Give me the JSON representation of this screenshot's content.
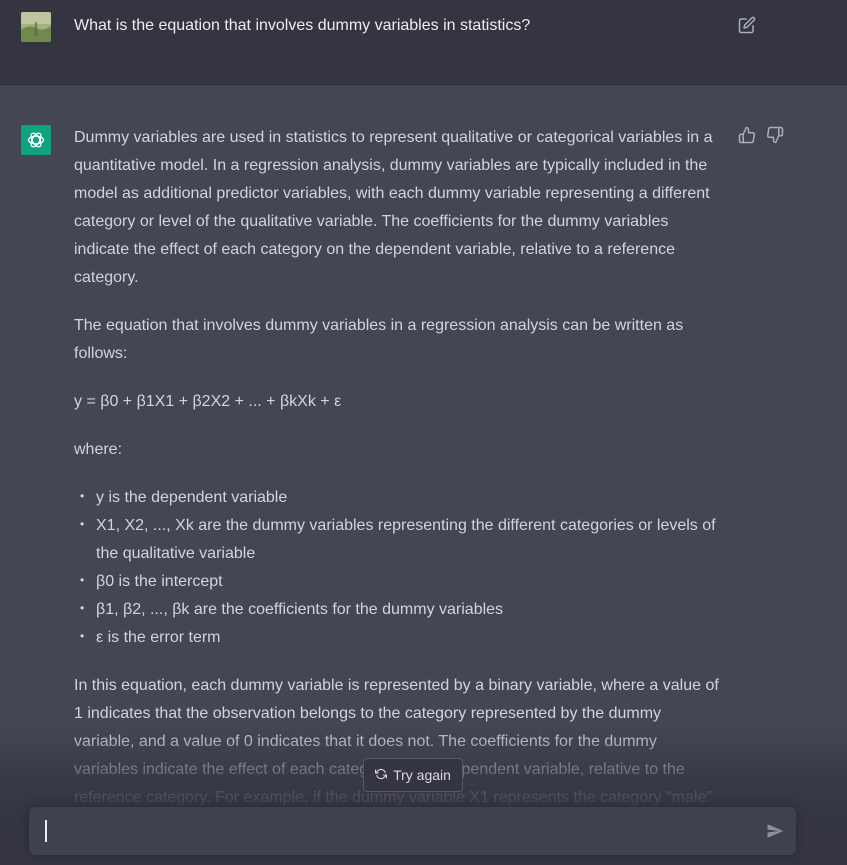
{
  "user_message": {
    "text": "What is the equation that involves dummy variables in statistics?",
    "avatar_icon": "user-avatar-photo",
    "edit_icon": "edit-icon"
  },
  "assistant": {
    "avatar_icon": "openai-logo-icon",
    "accent": "#10a37f",
    "paragraphs": [
      "Dummy variables are used in statistics to represent qualitative or categorical variables in a quantitative model. In a regression analysis, dummy variables are typically included in the model as additional predictor variables, with each dummy variable representing a different category or level of the qualitative variable. The coefficients for the dummy variables indicate the effect of each category on the dependent variable, relative to a reference category.",
      "The equation that involves dummy variables in a regression analysis can be written as follows:",
      "y = β0 + β1X1 + β2X2 + ... + βkXk + ε",
      "where:"
    ],
    "bullets": [
      "y is the dependent variable",
      "X1, X2, ..., Xk are the dummy variables representing the different categories or levels of the qualitative variable",
      "β0 is the intercept",
      "β1, β2, ..., βk are the coefficients for the dummy variables",
      "ε is the error term"
    ],
    "closing": "In this equation, each dummy variable is represented by a binary variable, where a value of 1 indicates that the observation belongs to the category represented by the dummy variable, and a value of 0 indicates that it does not. The coefficients for the dummy variables indicate the effect of each category on the dependent variable, relative to the reference category. For example, if the dummy variable X1 represents the category \"male\" and the dummy variable"
  },
  "actions": {
    "try_again_label": "Try again",
    "thumbs_up_icon": "thumbs-up-icon",
    "thumbs_down_icon": "thumbs-down-icon"
  },
  "composer": {
    "value": "",
    "send_icon": "send-icon"
  },
  "colors": {
    "page_bg": "#444654",
    "user_row_bg": "#343541",
    "composer_bg": "#40414f",
    "text": "#d1d5db"
  }
}
